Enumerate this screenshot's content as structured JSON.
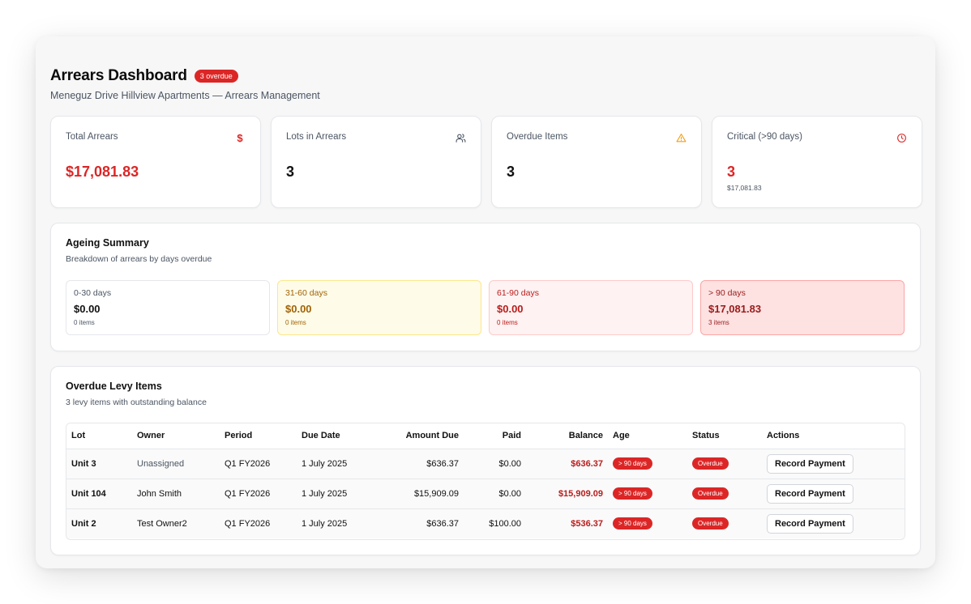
{
  "header": {
    "title": "Arrears Dashboard",
    "badge": "3 overdue",
    "subtitle": "Meneguz Drive Hillview Apartments — Arrears Management"
  },
  "stats": [
    {
      "label": "Total Arrears",
      "value": "$17,081.83",
      "icon": "dollar-icon",
      "sub": ""
    },
    {
      "label": "Lots in Arrears",
      "value": "3",
      "icon": "users-icon",
      "sub": ""
    },
    {
      "label": "Overdue Items",
      "value": "3",
      "icon": "warning-icon",
      "sub": ""
    },
    {
      "label": "Critical (>90 days)",
      "value": "3",
      "icon": "clock-icon",
      "sub": "$17,081.83"
    }
  ],
  "ageing": {
    "title": "Ageing Summary",
    "subtitle": "Breakdown of arrears by days overdue",
    "buckets": [
      {
        "label": "0-30 days",
        "value": "$0.00",
        "items": "0 items"
      },
      {
        "label": "31-60 days",
        "value": "$0.00",
        "items": "0 items"
      },
      {
        "label": "61-90 days",
        "value": "$0.00",
        "items": "0 items"
      },
      {
        "label": "> 90 days",
        "value": "$17,081.83",
        "items": "3 items"
      }
    ]
  },
  "overdue": {
    "title": "Overdue Levy Items",
    "subtitle": "3 levy items with outstanding balance",
    "columns": [
      "Lot",
      "Owner",
      "Period",
      "Due Date",
      "Amount Due",
      "Paid",
      "Balance",
      "Age",
      "Status",
      "Actions"
    ],
    "rows": [
      {
        "lot": "Unit 3",
        "owner": "Unassigned",
        "period": "Q1 FY2026",
        "due_date": "1 July 2025",
        "amount_due": "$636.37",
        "paid": "$0.00",
        "balance": "$636.37",
        "age": "> 90 days",
        "status": "Overdue",
        "action": "Record Payment"
      },
      {
        "lot": "Unit 104",
        "owner": "John Smith",
        "period": "Q1 FY2026",
        "due_date": "1 July 2025",
        "amount_due": "$15,909.09",
        "paid": "$0.00",
        "balance": "$15,909.09",
        "age": "> 90 days",
        "status": "Overdue",
        "action": "Record Payment"
      },
      {
        "lot": "Unit 2",
        "owner": "Test Owner2",
        "period": "Q1 FY2026",
        "due_date": "1 July 2025",
        "amount_due": "$636.37",
        "paid": "$100.00",
        "balance": "$536.37",
        "age": "> 90 days",
        "status": "Overdue",
        "action": "Record Payment"
      }
    ]
  },
  "colors": {
    "accent_red": "#dc2626",
    "warning_amber": "#f59e0b"
  }
}
